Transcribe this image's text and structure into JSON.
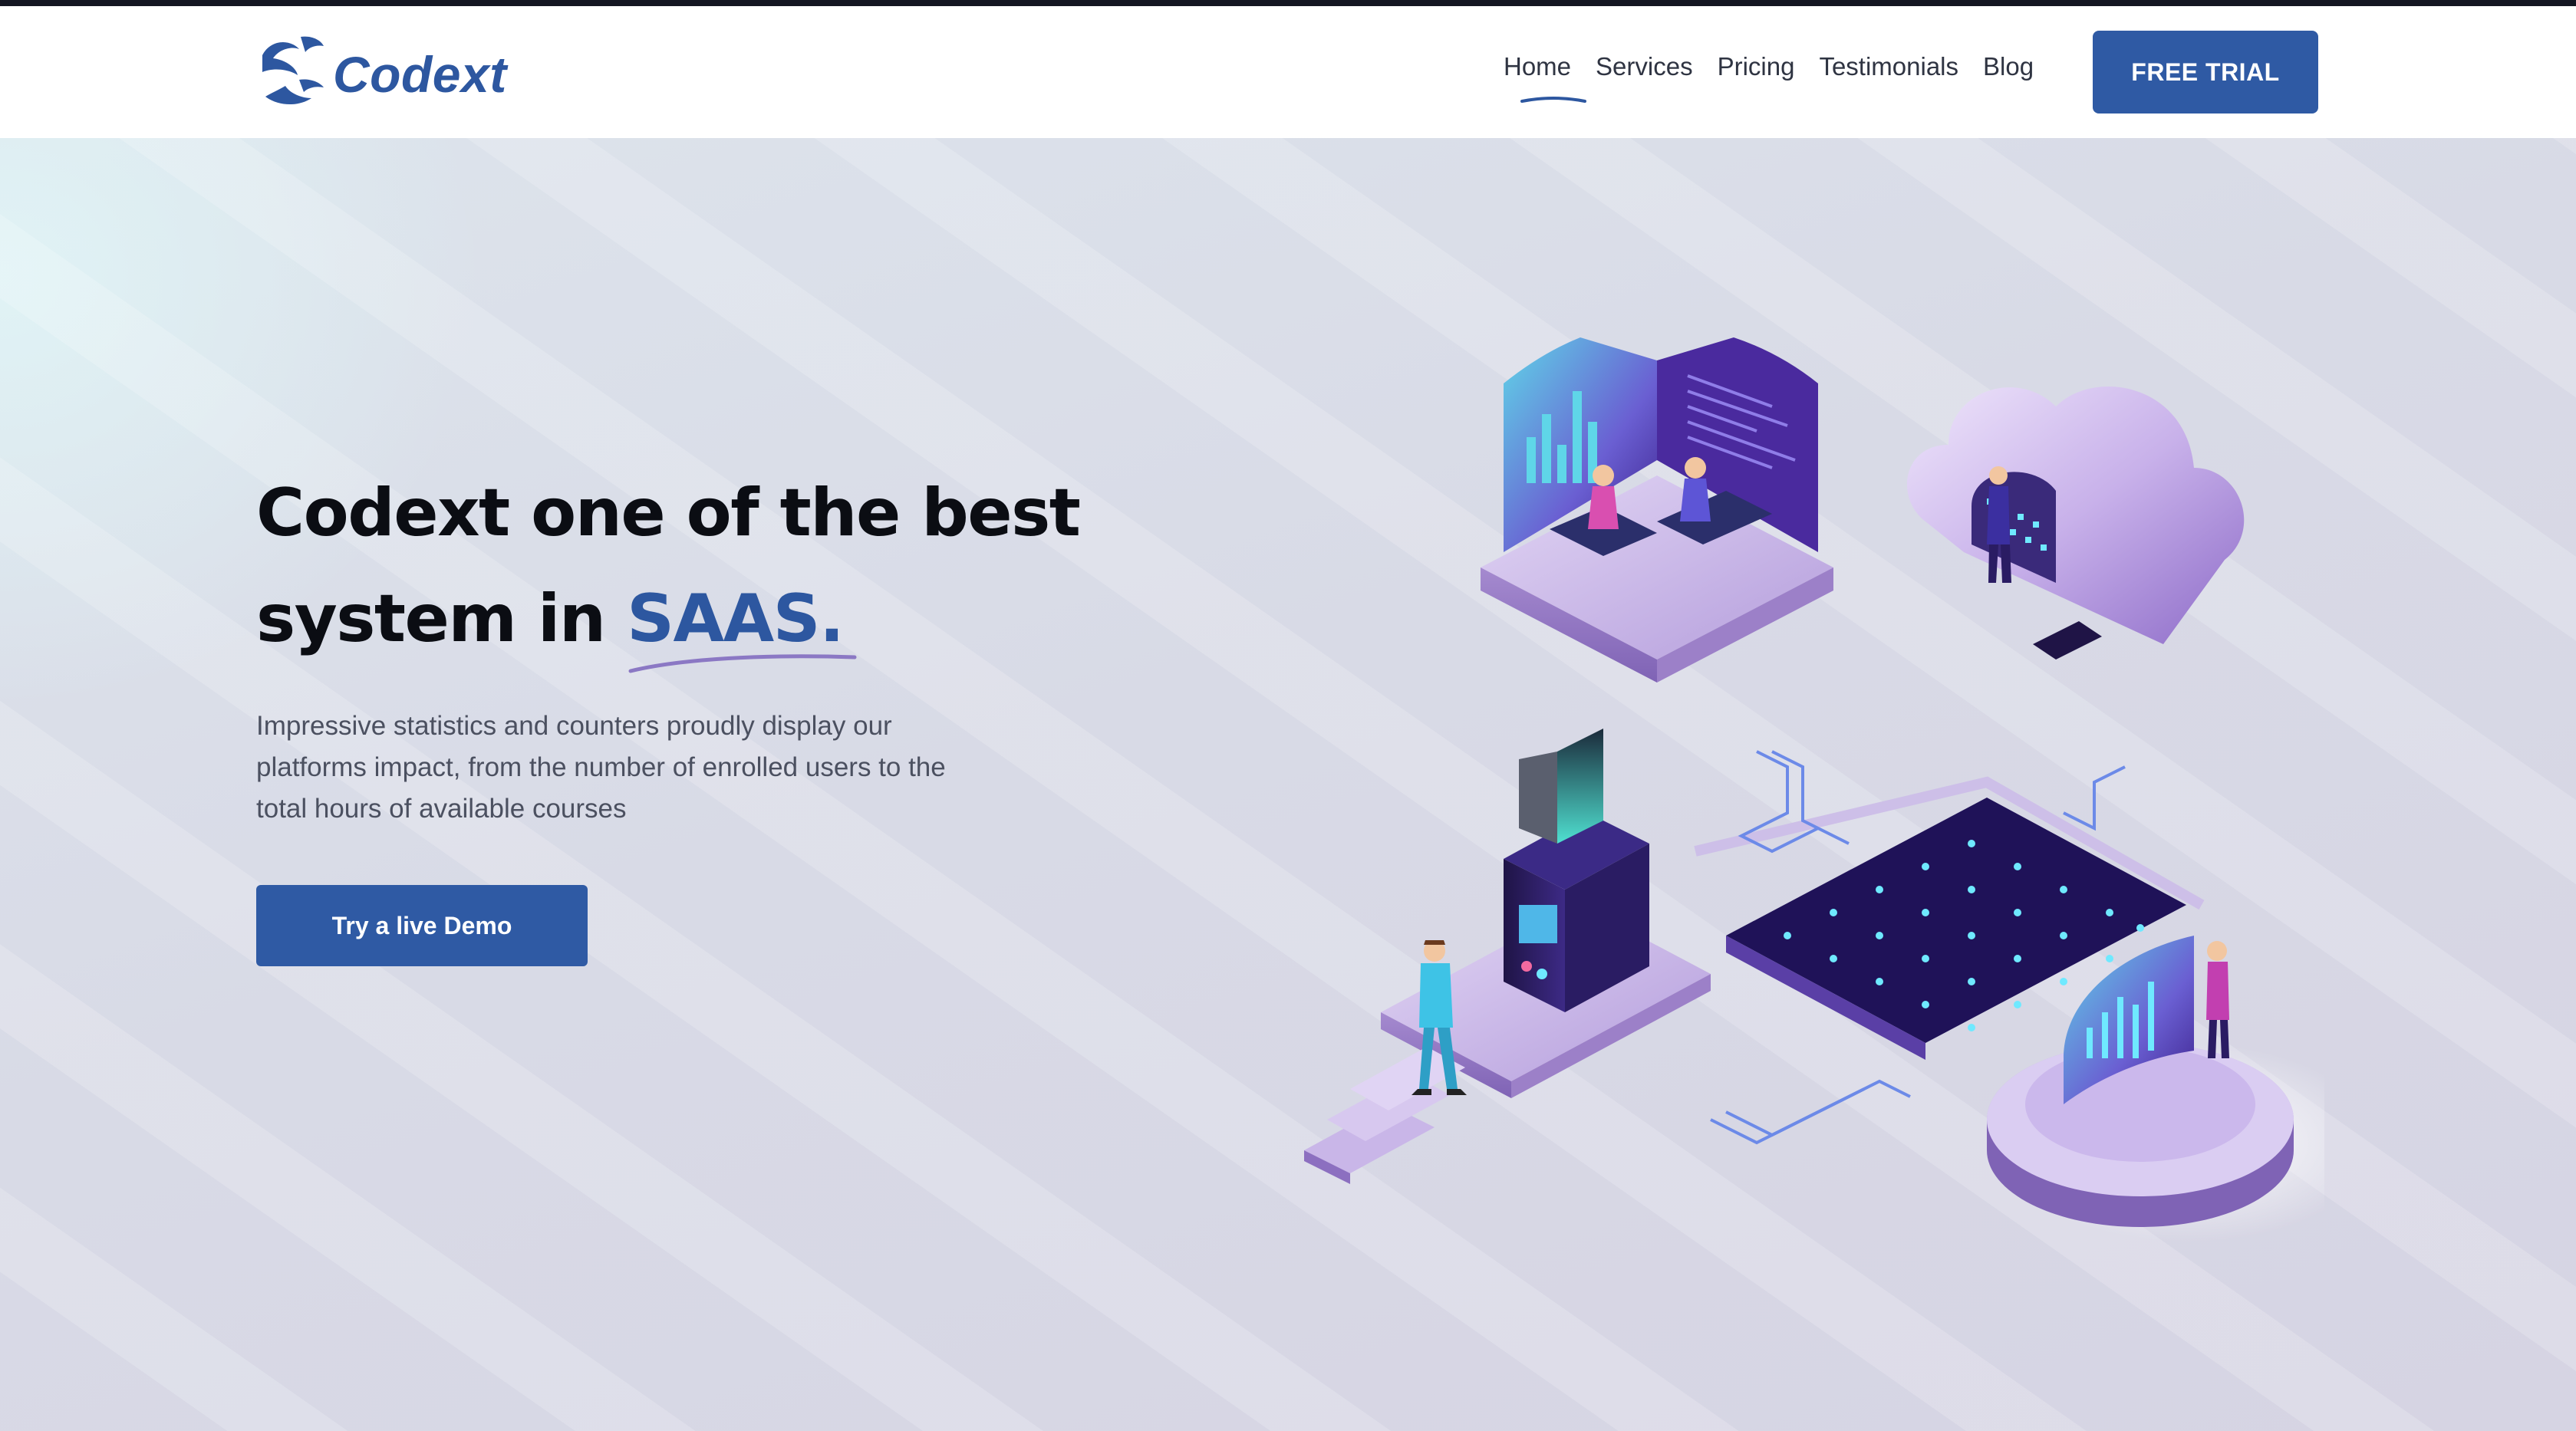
{
  "brand": {
    "name": "Codext",
    "color": "#2d57a0"
  },
  "nav": {
    "items": [
      {
        "label": "Home",
        "active": true
      },
      {
        "label": "Services",
        "active": false
      },
      {
        "label": "Pricing",
        "active": false
      },
      {
        "label": "Testimonials",
        "active": false
      },
      {
        "label": "Blog",
        "active": false
      }
    ],
    "cta_label": "FREE TRIAL"
  },
  "hero": {
    "title_part1": "Codext one of the best",
    "title_part2": "system in ",
    "title_accent": "SAAS.",
    "description": "Impressive statistics and counters proudly display our platforms impact, from the number of enrolled users to the total hours of available courses",
    "cta_label": "Try a live Demo",
    "illustration_icon": "isometric-saas-illustration"
  },
  "colors": {
    "primary": "#2f5aa4",
    "text_dark": "#0b0d13",
    "text_muted": "#4b5060",
    "accent_purple": "#7b5fc7",
    "accent_cyan": "#5fd6e8"
  }
}
